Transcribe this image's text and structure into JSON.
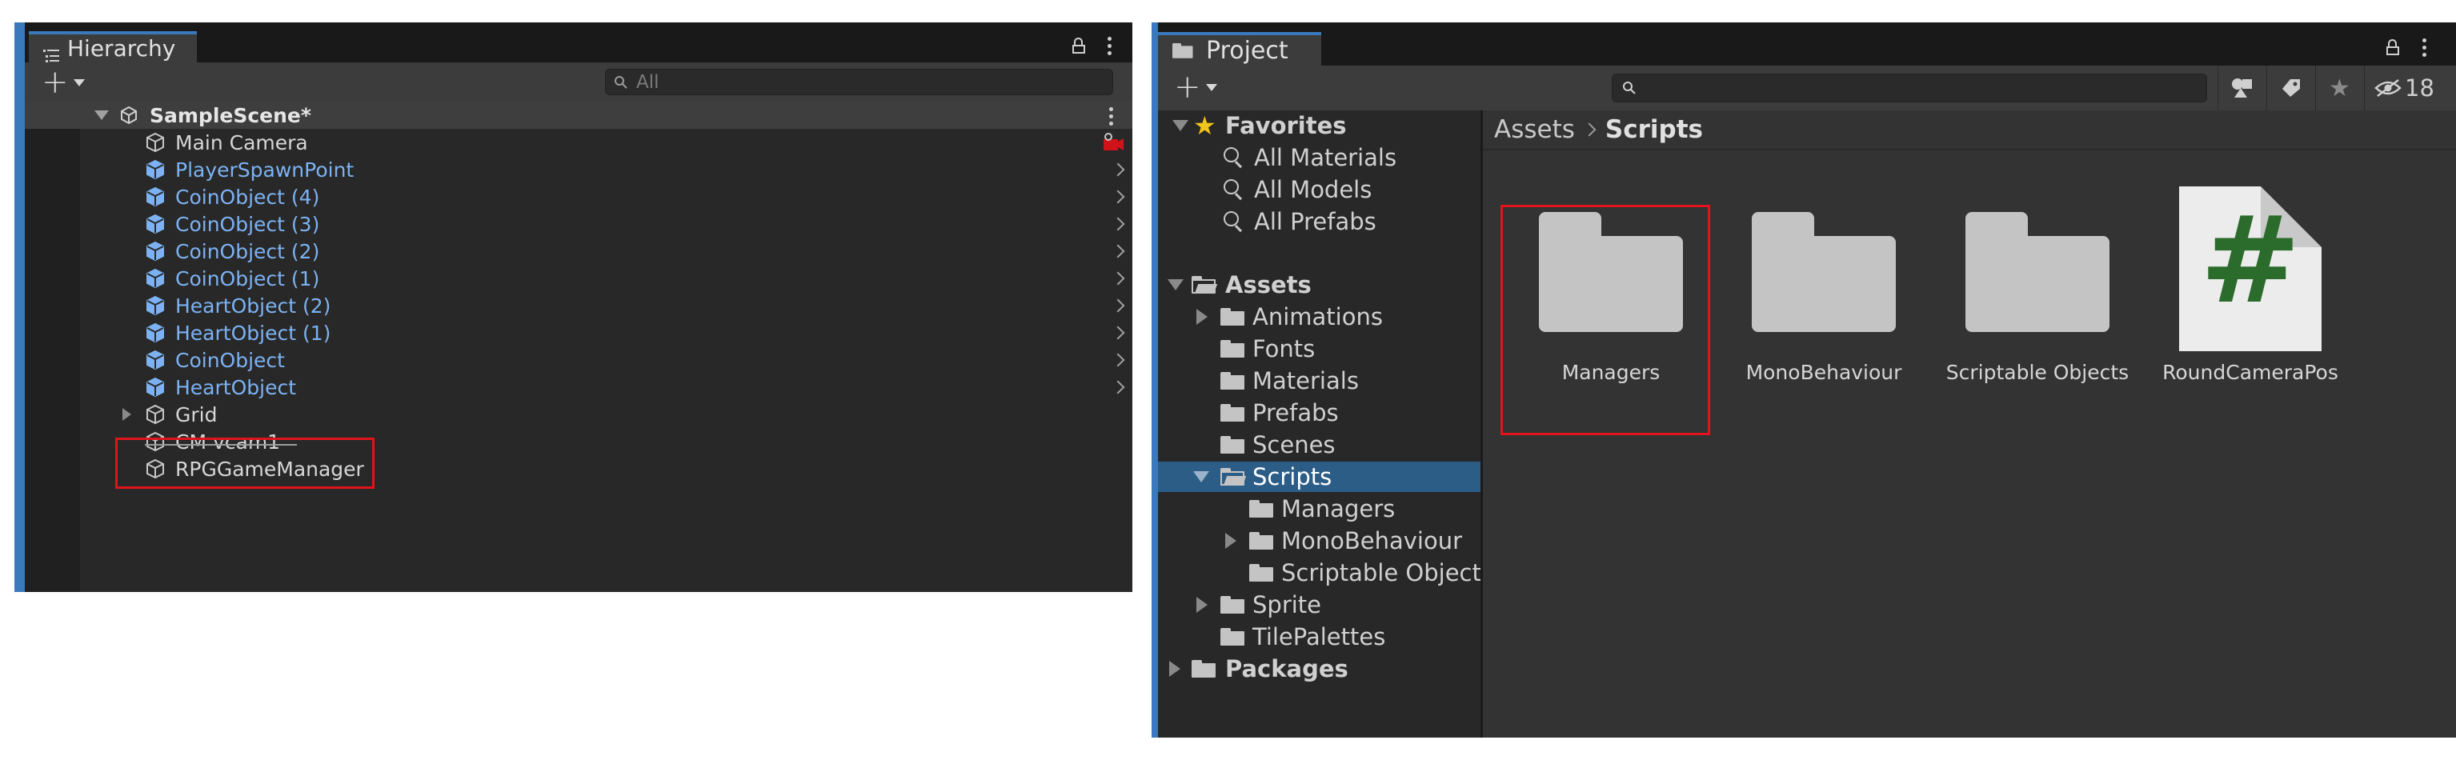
{
  "hierarchy": {
    "tab_label": "Hierarchy",
    "search_placeholder": "All",
    "scene": "SampleScene*",
    "items": [
      {
        "label": "Main Camera",
        "kind": "plain"
      },
      {
        "label": "PlayerSpawnPoint",
        "kind": "prefab"
      },
      {
        "label": "CoinObject (4)",
        "kind": "prefab"
      },
      {
        "label": "CoinObject (3)",
        "kind": "prefab"
      },
      {
        "label": "CoinObject (2)",
        "kind": "prefab"
      },
      {
        "label": "CoinObject (1)",
        "kind": "prefab"
      },
      {
        "label": "HeartObject (2)",
        "kind": "prefab"
      },
      {
        "label": "HeartObject (1)",
        "kind": "prefab"
      },
      {
        "label": "CoinObject",
        "kind": "prefab"
      },
      {
        "label": "HeartObject",
        "kind": "prefab"
      },
      {
        "label": "Grid",
        "kind": "plain"
      },
      {
        "label": "CM vcam1",
        "kind": "plain"
      },
      {
        "label": "RPGGameManager",
        "kind": "plain",
        "highlighted": true
      }
    ]
  },
  "project": {
    "tab_label": "Project",
    "hidden_count": "18",
    "favorites": {
      "label": "Favorites",
      "items": [
        "All Materials",
        "All Models",
        "All Prefabs"
      ]
    },
    "assets": {
      "label": "Assets",
      "folders": [
        "Animations",
        "Fonts",
        "Materials",
        "Prefabs",
        "Scenes",
        "Scripts",
        "Sprite",
        "TilePalettes"
      ],
      "script_subfolders": [
        "Managers",
        "MonoBehaviour",
        "Scriptable Object"
      ]
    },
    "packages_label": "Packages",
    "breadcrumb": {
      "root": "Assets",
      "current": "Scripts"
    },
    "grid_items": [
      {
        "name": "Managers",
        "type": "folder",
        "highlighted": true
      },
      {
        "name": "MonoBehaviour",
        "type": "folder"
      },
      {
        "name": "Scriptable Objects",
        "type": "folder"
      },
      {
        "name": "RoundCameraPos",
        "type": "script",
        "glyph": "#"
      }
    ]
  },
  "colors": {
    "accent": "#3a79bb",
    "prefab_text": "#7cb2f3",
    "highlight_box": "#e0141b",
    "selection": "#2c5d87",
    "script_hash": "#2b6b2b"
  }
}
